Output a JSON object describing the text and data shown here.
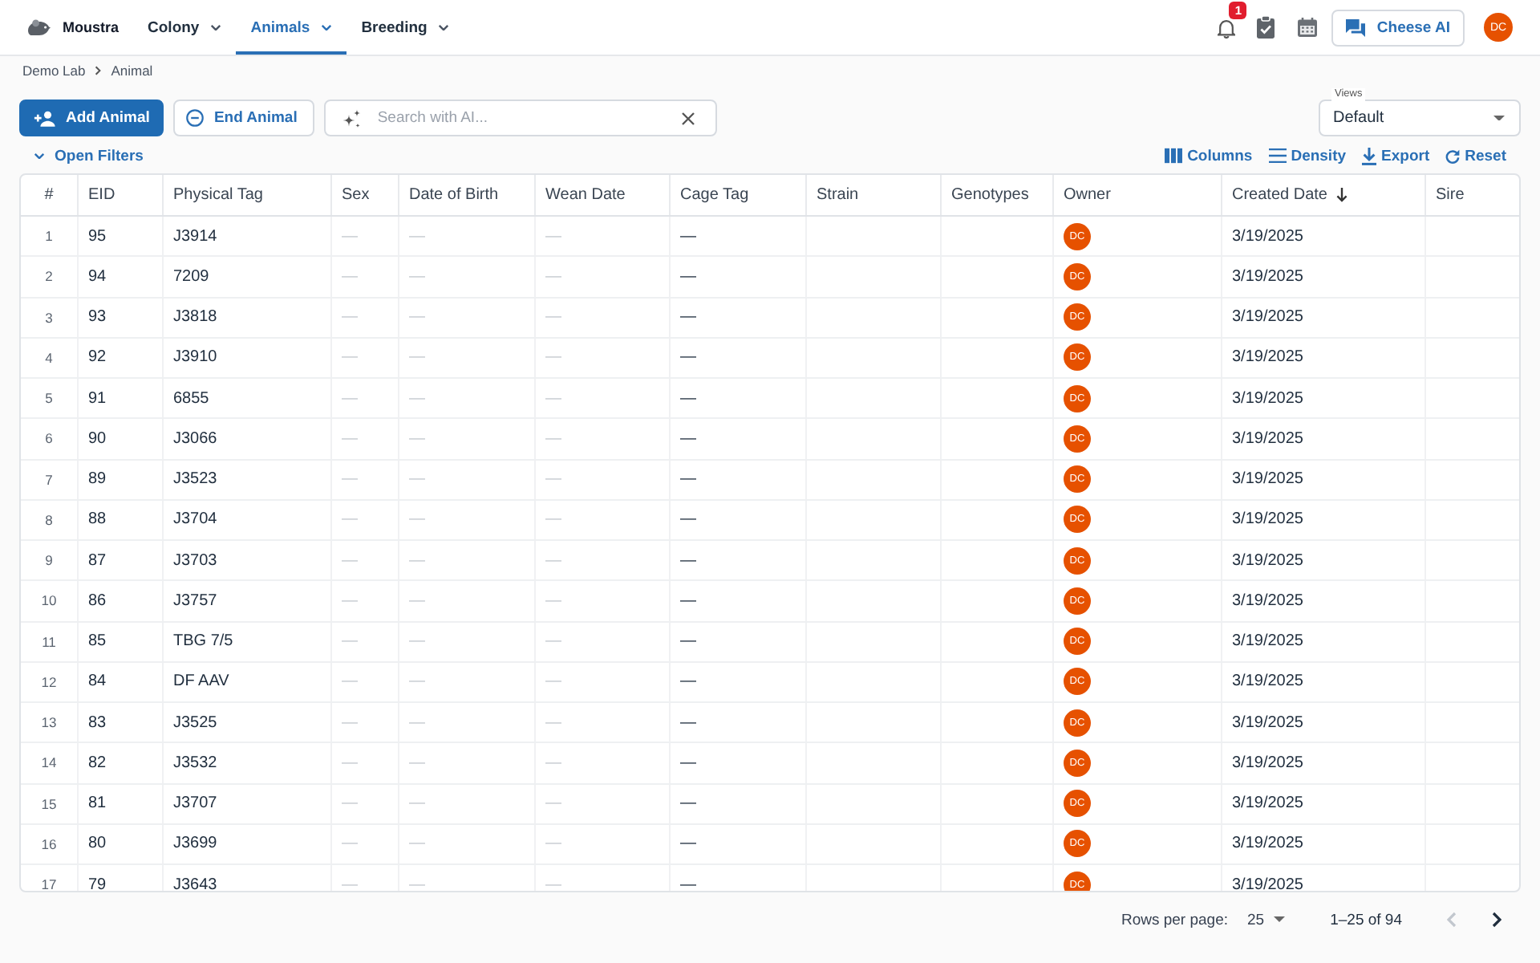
{
  "nav": {
    "brand": "Moustra",
    "tabs": [
      {
        "label": "Colony",
        "selected": false
      },
      {
        "label": "Animals",
        "selected": true
      },
      {
        "label": "Breeding",
        "selected": false
      }
    ],
    "notification_count": "1",
    "assistant_button": "Cheese AI",
    "user_avatar": "DC"
  },
  "breadcrumb": [
    {
      "label": "Demo Lab"
    },
    {
      "label": "Animal"
    }
  ],
  "toolbar": {
    "buttons": [
      {
        "label": "Add Animal",
        "kind": "add"
      },
      {
        "label": "End Animal",
        "kind": "end"
      }
    ],
    "search": {
      "placeholder": "Search with AI..."
    },
    "views": {
      "label": "Views",
      "value": "Default"
    }
  },
  "filters_toggle": "Open Filters",
  "grid_actions": [
    {
      "label": "Columns",
      "kind": "columns"
    },
    {
      "label": "Density",
      "kind": "density"
    },
    {
      "label": "Export",
      "kind": "export"
    },
    {
      "label": "Reset",
      "kind": "reset"
    }
  ],
  "table": {
    "columns": [
      {
        "label": "#",
        "kind": "index",
        "sorted": false
      },
      {
        "label": "EID",
        "kind": "text",
        "sorted": false
      },
      {
        "label": "Physical Tag",
        "kind": "text",
        "sorted": false
      },
      {
        "label": "Sex",
        "kind": "muted",
        "sorted": false
      },
      {
        "label": "Date of Birth",
        "kind": "muted",
        "sorted": false
      },
      {
        "label": "Wean Date",
        "kind": "muted",
        "sorted": false
      },
      {
        "label": "Cage Tag",
        "kind": "text",
        "sorted": false
      },
      {
        "label": "Strain",
        "kind": "text",
        "sorted": false
      },
      {
        "label": "Genotypes",
        "kind": "text",
        "sorted": false
      },
      {
        "label": "Owner",
        "kind": "avatar",
        "sorted": false
      },
      {
        "label": "Created Date",
        "kind": "text",
        "sorted": true
      },
      {
        "label": "Sire",
        "kind": "text",
        "sorted": false
      }
    ],
    "rows": [
      {
        "index": "1",
        "eid": "95",
        "physical_tag": "J3914",
        "sex": "—",
        "date_of_birth": "—",
        "wean_date": "—",
        "cage_tag": "—",
        "owner": "DC",
        "created_date": "3/19/2025"
      },
      {
        "index": "2",
        "eid": "94",
        "physical_tag": "7209",
        "sex": "—",
        "date_of_birth": "—",
        "wean_date": "—",
        "cage_tag": "—",
        "owner": "DC",
        "created_date": "3/19/2025"
      },
      {
        "index": "3",
        "eid": "93",
        "physical_tag": "J3818",
        "sex": "—",
        "date_of_birth": "—",
        "wean_date": "—",
        "cage_tag": "—",
        "owner": "DC",
        "created_date": "3/19/2025"
      },
      {
        "index": "4",
        "eid": "92",
        "physical_tag": "J3910",
        "sex": "—",
        "date_of_birth": "—",
        "wean_date": "—",
        "cage_tag": "—",
        "owner": "DC",
        "created_date": "3/19/2025"
      },
      {
        "index": "5",
        "eid": "91",
        "physical_tag": "6855",
        "sex": "—",
        "date_of_birth": "—",
        "wean_date": "—",
        "cage_tag": "—",
        "owner": "DC",
        "created_date": "3/19/2025"
      },
      {
        "index": "6",
        "eid": "90",
        "physical_tag": "J3066",
        "sex": "—",
        "date_of_birth": "—",
        "wean_date": "—",
        "cage_tag": "—",
        "owner": "DC",
        "created_date": "3/19/2025"
      },
      {
        "index": "7",
        "eid": "89",
        "physical_tag": "J3523",
        "sex": "—",
        "date_of_birth": "—",
        "wean_date": "—",
        "cage_tag": "—",
        "owner": "DC",
        "created_date": "3/19/2025"
      },
      {
        "index": "8",
        "eid": "88",
        "physical_tag": "J3704",
        "sex": "—",
        "date_of_birth": "—",
        "wean_date": "—",
        "cage_tag": "—",
        "owner": "DC",
        "created_date": "3/19/2025"
      },
      {
        "index": "9",
        "eid": "87",
        "physical_tag": "J3703",
        "sex": "—",
        "date_of_birth": "—",
        "wean_date": "—",
        "cage_tag": "—",
        "owner": "DC",
        "created_date": "3/19/2025"
      },
      {
        "index": "10",
        "eid": "86",
        "physical_tag": "J3757",
        "sex": "—",
        "date_of_birth": "—",
        "wean_date": "—",
        "cage_tag": "—",
        "owner": "DC",
        "created_date": "3/19/2025"
      },
      {
        "index": "11",
        "eid": "85",
        "physical_tag": "TBG 7/5",
        "sex": "—",
        "date_of_birth": "—",
        "wean_date": "—",
        "cage_tag": "—",
        "owner": "DC",
        "created_date": "3/19/2025"
      },
      {
        "index": "12",
        "eid": "84",
        "physical_tag": "DF AAV",
        "sex": "—",
        "date_of_birth": "—",
        "wean_date": "—",
        "cage_tag": "—",
        "owner": "DC",
        "created_date": "3/19/2025"
      },
      {
        "index": "13",
        "eid": "83",
        "physical_tag": "J3525",
        "sex": "—",
        "date_of_birth": "—",
        "wean_date": "—",
        "cage_tag": "—",
        "owner": "DC",
        "created_date": "3/19/2025"
      },
      {
        "index": "14",
        "eid": "82",
        "physical_tag": "J3532",
        "sex": "—",
        "date_of_birth": "—",
        "wean_date": "—",
        "cage_tag": "—",
        "owner": "DC",
        "created_date": "3/19/2025"
      },
      {
        "index": "15",
        "eid": "81",
        "physical_tag": "J3707",
        "sex": "—",
        "date_of_birth": "—",
        "wean_date": "—",
        "cage_tag": "—",
        "owner": "DC",
        "created_date": "3/19/2025"
      },
      {
        "index": "16",
        "eid": "80",
        "physical_tag": "J3699",
        "sex": "—",
        "date_of_birth": "—",
        "wean_date": "—",
        "cage_tag": "—",
        "owner": "DC",
        "created_date": "3/19/2025"
      },
      {
        "index": "17",
        "eid": "79",
        "physical_tag": "J3643",
        "sex": "—",
        "date_of_birth": "—",
        "wean_date": "—",
        "cage_tag": "—",
        "owner": "DC",
        "created_date": "3/19/2025"
      }
    ]
  },
  "pagination": {
    "rows_per_page_label": "Rows per page:",
    "rows_per_page": "25",
    "range": "1–25 of 94",
    "page_buttons": [
      {
        "kind": "previous",
        "disabled": true
      },
      {
        "kind": "next",
        "disabled": false
      }
    ]
  }
}
